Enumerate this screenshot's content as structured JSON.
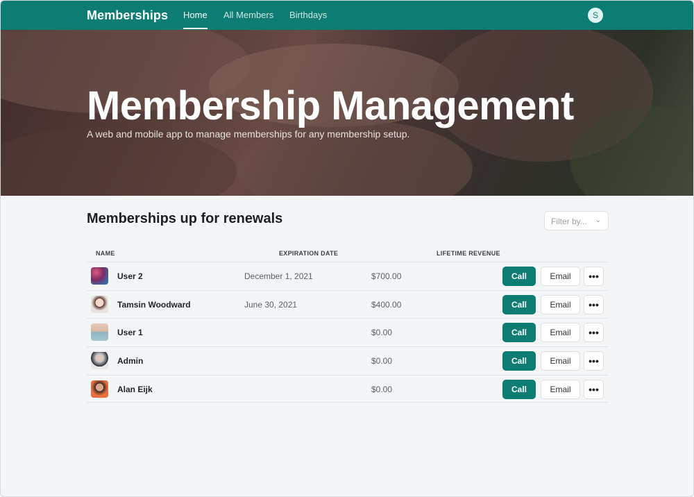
{
  "nav": {
    "brand": "Memberships",
    "links": [
      {
        "label": "Home"
      },
      {
        "label": "All Members"
      },
      {
        "label": "Birthdays"
      }
    ],
    "user_initial": "S"
  },
  "hero": {
    "title": "Membership Management",
    "subtitle": "A web and mobile app to manage memberships for any membership setup."
  },
  "renewals": {
    "title": "Memberships up for renewals",
    "filter_placeholder": "Filter by...",
    "columns": [
      "NAME",
      "EXPIRATION DATE",
      "LIFETIME REVENUE"
    ],
    "rows": [
      {
        "name": "User 2",
        "expiration": "December 1, 2021",
        "revenue": "$700.00"
      },
      {
        "name": "Tamsin Woodward",
        "expiration": "June 30, 2021",
        "revenue": "$400.00"
      },
      {
        "name": "User 1",
        "expiration": "",
        "revenue": "$0.00"
      },
      {
        "name": "Admin",
        "expiration": "",
        "revenue": "$0.00"
      },
      {
        "name": "Alan Eijk",
        "expiration": "",
        "revenue": "$0.00"
      }
    ],
    "actions": {
      "call": "Call",
      "email": "Email",
      "more": "•••"
    }
  },
  "colors": {
    "accent": "#0d7d73",
    "page_bg": "#f4f5f7"
  },
  "icons": {
    "filter": "chevron-down-icon",
    "more": "more-horizontal-icon"
  }
}
